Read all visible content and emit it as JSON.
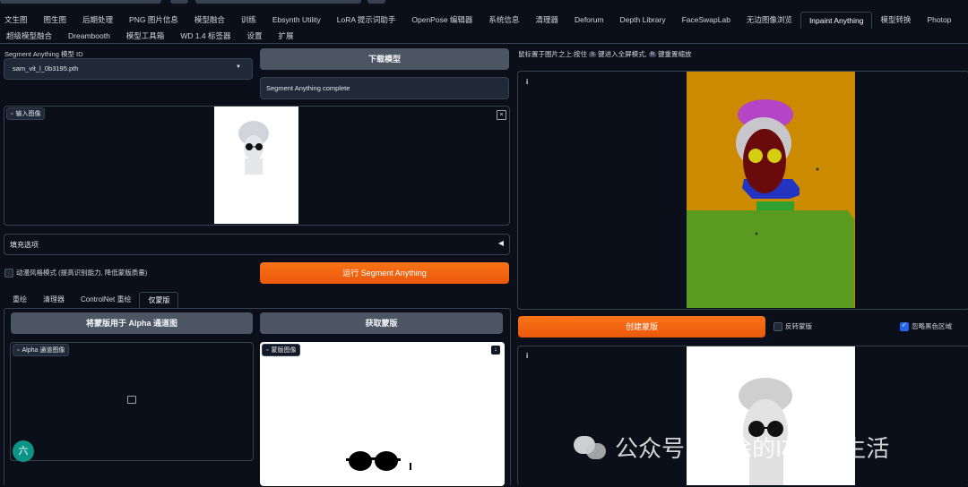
{
  "top_tabs_row1": [
    "文生图",
    "图生图",
    "后期处理",
    "PNG 图片信息",
    "模型融合",
    "训练",
    "Ebsynth Utility",
    "LoRA 提示词助手",
    "OpenPose 编辑器",
    "系统信息",
    "清理器",
    "Deforum",
    "Depth Library",
    "FaceSwapLab",
    "无边图像浏览",
    "Inpaint Anything",
    "模型转换",
    "Photop"
  ],
  "top_tabs_row2": [
    "超级模型融合",
    "Dreambooth",
    "模型工具箱",
    "WD 1.4 标签器",
    "设置",
    "扩展"
  ],
  "active_tab": "Inpaint Anything",
  "sam": {
    "model_label": "Segment Anything 模型 ID",
    "model_value": "sam_vit_l_0b3195.pth",
    "download_button": "下载模型",
    "status": "Segment Anything complete",
    "input_label": "输入图像",
    "fill_options": "填充选项",
    "anime_mode": "动漫风格模式 (提高识别能力, 降低蒙版质量)",
    "run_button": "运行 Segment Anything"
  },
  "right": {
    "hint_prefix": "鼠标置于图片之上:按住",
    "key_s": "S",
    "hint_mid": "键进入全屏模式,",
    "key_r": "R",
    "hint_suffix": "键重置缩放",
    "create_mask_button": "创建蒙版",
    "invert_mask": "反转蒙版",
    "ignore_black": "忽略黑色区域",
    "seg_panel_marker": "i",
    "result_panel_marker": "i"
  },
  "sub_tabs": [
    "重绘",
    "清理器",
    "ControlNet 重绘",
    "仅蒙版"
  ],
  "active_sub_tab": "仅蒙版",
  "mask_only": {
    "alpha_button": "将蒙版用于 Alpha 通道图",
    "get_mask_button": "获取蒙版",
    "alpha_label": "Alpha 通道图像",
    "mask_label": "蒙版图像"
  },
  "watermark": {
    "text": "公众号 · 老徐的IT技术生活"
  },
  "floating_badge": "六",
  "colors": {
    "accent": "#f97316",
    "bg": "#0b0f19",
    "panel_border": "#374151",
    "button_gray": "#4b5563",
    "check_blue": "#2563eb"
  }
}
